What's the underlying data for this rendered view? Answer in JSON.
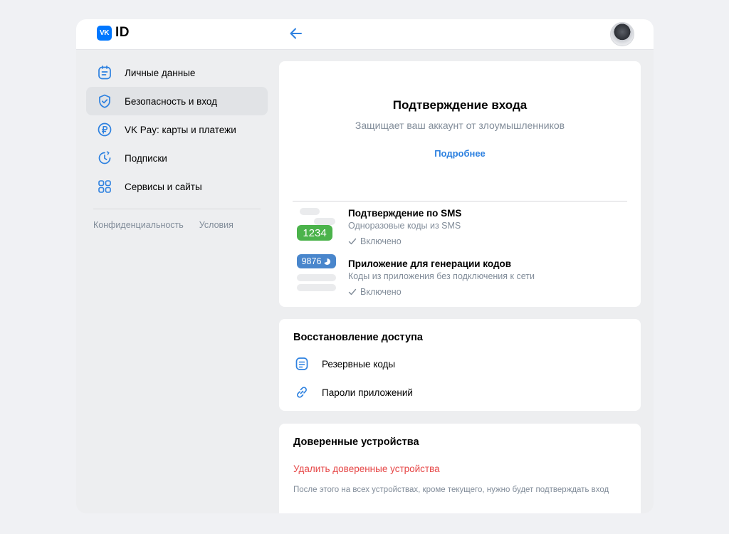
{
  "brand": {
    "badge": "VK",
    "name": "ID"
  },
  "header": {
    "back_icon": "arrow-left-icon",
    "avatar": "user-avatar"
  },
  "sidebar": {
    "items": [
      {
        "label": "Личные данные",
        "icon": "profile-card-icon",
        "active": false
      },
      {
        "label": "Безопасность и вход",
        "icon": "shield-check-icon",
        "active": true
      },
      {
        "label": "VK Pay: карты и платежи",
        "icon": "ruble-coin-icon",
        "active": false
      },
      {
        "label": "Подписки",
        "icon": "clock-refresh-icon",
        "active": false
      },
      {
        "label": "Сервисы и сайты",
        "icon": "apps-grid-icon",
        "active": false
      }
    ],
    "links": {
      "privacy": "Конфиденциальность",
      "terms": "Условия"
    }
  },
  "login_confirmation": {
    "title": "Подтверждение входа",
    "subtitle": "Защищает ваш аккаунт от злоумышленников",
    "more_link": "Подробнее",
    "methods": [
      {
        "title": "Подтверждение по SMS",
        "description": "Одноразовые коды из SMS",
        "status": "Включено",
        "badge": "1234"
      },
      {
        "title": "Приложение для генерации кодов",
        "description": "Коды из приложения без подключения к сети",
        "status": "Включено",
        "badge": "9876"
      }
    ]
  },
  "recovery": {
    "title": "Восстановление доступа",
    "items": [
      {
        "label": "Резервные коды",
        "icon": "document-list-icon"
      },
      {
        "label": "Пароли приложений",
        "icon": "link-icon"
      }
    ]
  },
  "trusted_devices": {
    "title": "Доверенные устройства",
    "remove_link": "Удалить доверенные устройства",
    "note": "После этого на всех устройствах, кроме текущего, нужно будет подтверждать вход"
  },
  "colors": {
    "accent": "#0077ff",
    "link": "#2d81e0",
    "danger": "#e64646",
    "success": "#4bb34b"
  }
}
